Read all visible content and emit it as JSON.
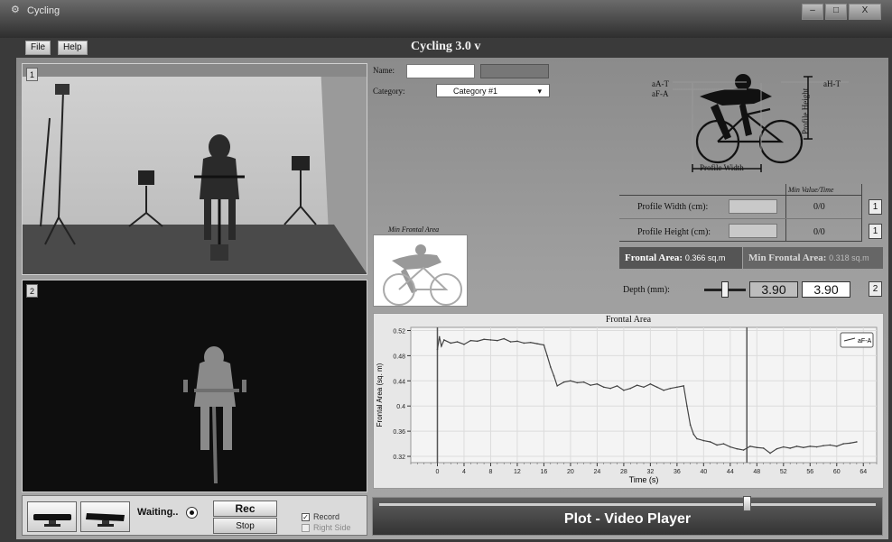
{
  "window": {
    "title": "Cycling",
    "app_title": "Cycling 3.0 v"
  },
  "menu": {
    "file": "File",
    "help": "Help"
  },
  "views": {
    "top_number": "1",
    "bottom_number": "2"
  },
  "controls": {
    "waiting_label": "Waiting..",
    "rec_label": "Rec",
    "stop_label": "Stop",
    "record_label": "Record",
    "record_checked": true,
    "right_side_label": "Right Side",
    "right_side_checked": false
  },
  "form": {
    "name_label": "Name:",
    "name_value": "",
    "category_label": "Category:",
    "category_value": "Category #1"
  },
  "diagram": {
    "aA_T": "aA-T",
    "aF_A": "aF-A",
    "aH_T": "aH-T",
    "profile_height": "Profile Height",
    "profile_width": "Profile Width"
  },
  "min_frontal_caption": "Min Frontal Area",
  "measures": {
    "header": "Min Value/Time",
    "profile_width_label": "Profile Width (cm):",
    "profile_width_value": "0/0",
    "profile_width_btn": "1",
    "profile_height_label": "Profile Height (cm):",
    "profile_height_value": "0/0",
    "profile_height_btn": "1"
  },
  "frontal": {
    "label": "Frontal Area:",
    "value": "0.366 sq.m",
    "min_label": "Min Frontal Area:",
    "min_value": "0.318 sq.m"
  },
  "depth": {
    "label": "Depth (mm):",
    "value1": "3.90",
    "value2": "3.90",
    "button": "2",
    "slider_fraction": 0.5
  },
  "player": {
    "label": "Plot - Video Player",
    "position_fraction": 0.74
  },
  "chart_data": {
    "type": "line",
    "title": "Frontal Area",
    "xlabel": "Time (s)",
    "ylabel": "Frontal Area (sq. m)",
    "xlim": [
      -4,
      66
    ],
    "ylim": [
      0.31,
      0.525
    ],
    "xticks": [
      0,
      4,
      8,
      12,
      16,
      20,
      24,
      28,
      32,
      36,
      40,
      44,
      48,
      52,
      56,
      60,
      64
    ],
    "yticks": [
      0.32,
      0.36,
      0.4,
      0.44,
      0.48,
      0.52
    ],
    "ytick_labels": [
      "0.32",
      "0.36",
      "0.4",
      "0.44",
      "0.48",
      "0.52"
    ],
    "grid": true,
    "legend": "top-right",
    "cursor_x": [
      0,
      46.5
    ],
    "series": [
      {
        "name": "aF-A",
        "x": [
          0,
          0.3,
          0.6,
          1,
          2,
          3,
          4,
          5,
          6,
          7,
          8,
          9,
          10,
          11,
          12,
          13,
          14,
          15,
          16,
          16.5,
          17,
          17.5,
          18,
          19,
          20,
          21,
          22,
          23,
          24,
          25,
          26,
          27,
          28,
          29,
          30,
          31,
          32,
          33,
          34,
          35,
          36,
          37,
          37.5,
          38,
          38.5,
          39,
          40,
          41,
          42,
          43,
          44,
          45,
          46,
          47,
          48,
          49,
          50,
          51,
          52,
          53,
          54,
          55,
          56,
          57,
          58,
          59,
          60,
          61,
          62,
          63
        ],
        "values": [
          0.49,
          0.51,
          0.495,
          0.505,
          0.5,
          0.502,
          0.498,
          0.504,
          0.503,
          0.506,
          0.505,
          0.504,
          0.507,
          0.502,
          0.503,
          0.5,
          0.501,
          0.499,
          0.497,
          0.48,
          0.462,
          0.448,
          0.432,
          0.438,
          0.44,
          0.437,
          0.438,
          0.433,
          0.435,
          0.43,
          0.428,
          0.432,
          0.425,
          0.428,
          0.433,
          0.43,
          0.435,
          0.43,
          0.425,
          0.428,
          0.43,
          0.432,
          0.4,
          0.37,
          0.355,
          0.348,
          0.345,
          0.343,
          0.338,
          0.34,
          0.335,
          0.332,
          0.33,
          0.336,
          0.334,
          0.333,
          0.325,
          0.332,
          0.335,
          0.333,
          0.336,
          0.334,
          0.336,
          0.335,
          0.337,
          0.338,
          0.336,
          0.34,
          0.341,
          0.343
        ]
      }
    ]
  },
  "colors": {
    "line": "#444444",
    "cursor": "#555555",
    "panel_bg": "#e7e7e7"
  }
}
